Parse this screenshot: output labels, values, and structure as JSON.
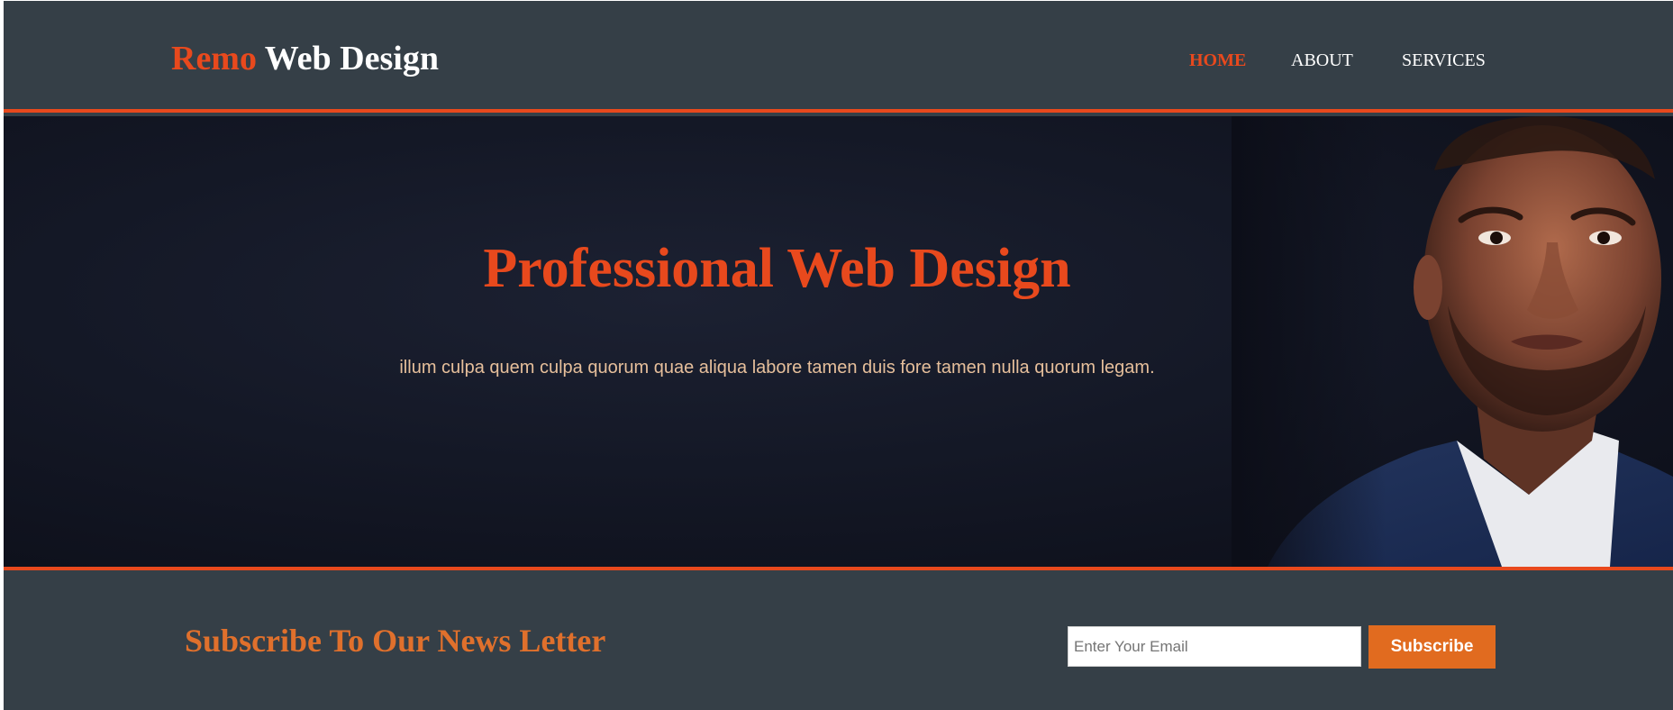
{
  "header": {
    "logo_highlight": "Remo",
    "logo_rest": " Web Design",
    "nav": [
      {
        "label": "HOME",
        "active": true
      },
      {
        "label": "ABOUT",
        "active": false
      },
      {
        "label": "SERVICES",
        "active": false
      }
    ]
  },
  "showcase": {
    "title": "Professional Web Design",
    "text": "illum culpa quem culpa quorum quae aliqua labore tamen duis fore tamen nulla quorum legam."
  },
  "newsletter": {
    "title": "Subscribe To Our News Letter",
    "email_placeholder": "Enter Your Email",
    "button_label": "Subscribe"
  },
  "colors": {
    "accent": "#e8491d",
    "header_bg": "#353f47",
    "button_bg": "#e16b1f",
    "subtitle_text": "#e6bf9b"
  }
}
